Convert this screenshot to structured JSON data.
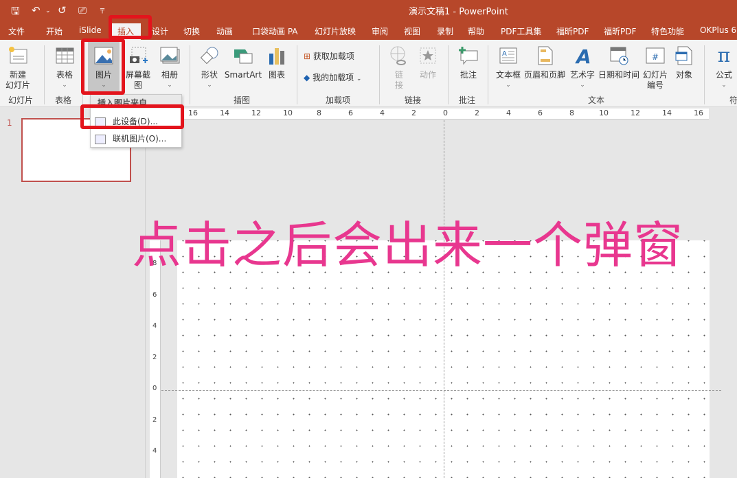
{
  "window": {
    "title": "演示文稿1  -  PowerPoint"
  },
  "qat": [
    {
      "icon": "save-icon",
      "glyph": "🖫"
    },
    {
      "icon": "undo-icon",
      "glyph": "↶"
    },
    {
      "icon": "redo-icon",
      "glyph": "↺"
    },
    {
      "icon": "present-icon",
      "glyph": "⎚"
    },
    {
      "icon": "customize-icon",
      "glyph": "╤"
    }
  ],
  "tabs": [
    "文件",
    "开始",
    "iSlide",
    "插入",
    "设计",
    "切换",
    "动画",
    "口袋动画 PA",
    "幻灯片放映",
    "审阅",
    "视图",
    "录制",
    "帮助",
    "PDF工具集",
    "福昕PDF",
    "福昕PDF",
    "特色功能",
    "OKPlus 6."
  ],
  "active_tab": "插入",
  "ribbon": {
    "buttons": {
      "new_slide": "新建\n幻灯片",
      "table": "表格",
      "picture": "图片",
      "screenshot": "屏幕截图",
      "album": "相册",
      "shapes": "形状",
      "smartart": "SmartArt",
      "chart": "图表",
      "get_addins": "获取加载项",
      "my_addins": "我的加载项",
      "link": "链\n接",
      "action": "动作",
      "comment": "批注",
      "textbox": "文本框",
      "header_footer": "页眉和页脚",
      "wordart": "艺术字",
      "datetime": "日期和时间",
      "slide_number": "幻灯片\n编号",
      "object": "对象",
      "equation": "公式"
    },
    "groups": {
      "slides": "幻灯片",
      "tables": "表格",
      "illustrations": "插图",
      "addins": "加载项",
      "links": "链接",
      "comments": "批注",
      "text": "文本",
      "symbols": "符"
    }
  },
  "picture_menu": {
    "header": "插入图片来自",
    "items": [
      "此设备(D)...",
      "联机图片(O)..."
    ]
  },
  "slides_pane": {
    "slide_number": "1"
  },
  "ruler": {
    "horizontal": [
      "16",
      "14",
      "12",
      "10",
      "8",
      "6",
      "4",
      "2",
      "0",
      "2",
      "4",
      "6",
      "8",
      "10",
      "12",
      "14",
      "16"
    ],
    "vertical": [
      "8",
      "6",
      "4",
      "2",
      "0",
      "2",
      "4"
    ]
  },
  "annotation": {
    "text": "点击之后会出来一个弹窗",
    "color": "#e8378f"
  },
  "colors": {
    "brand": "#b7472a",
    "highlight": "#e3141c"
  }
}
